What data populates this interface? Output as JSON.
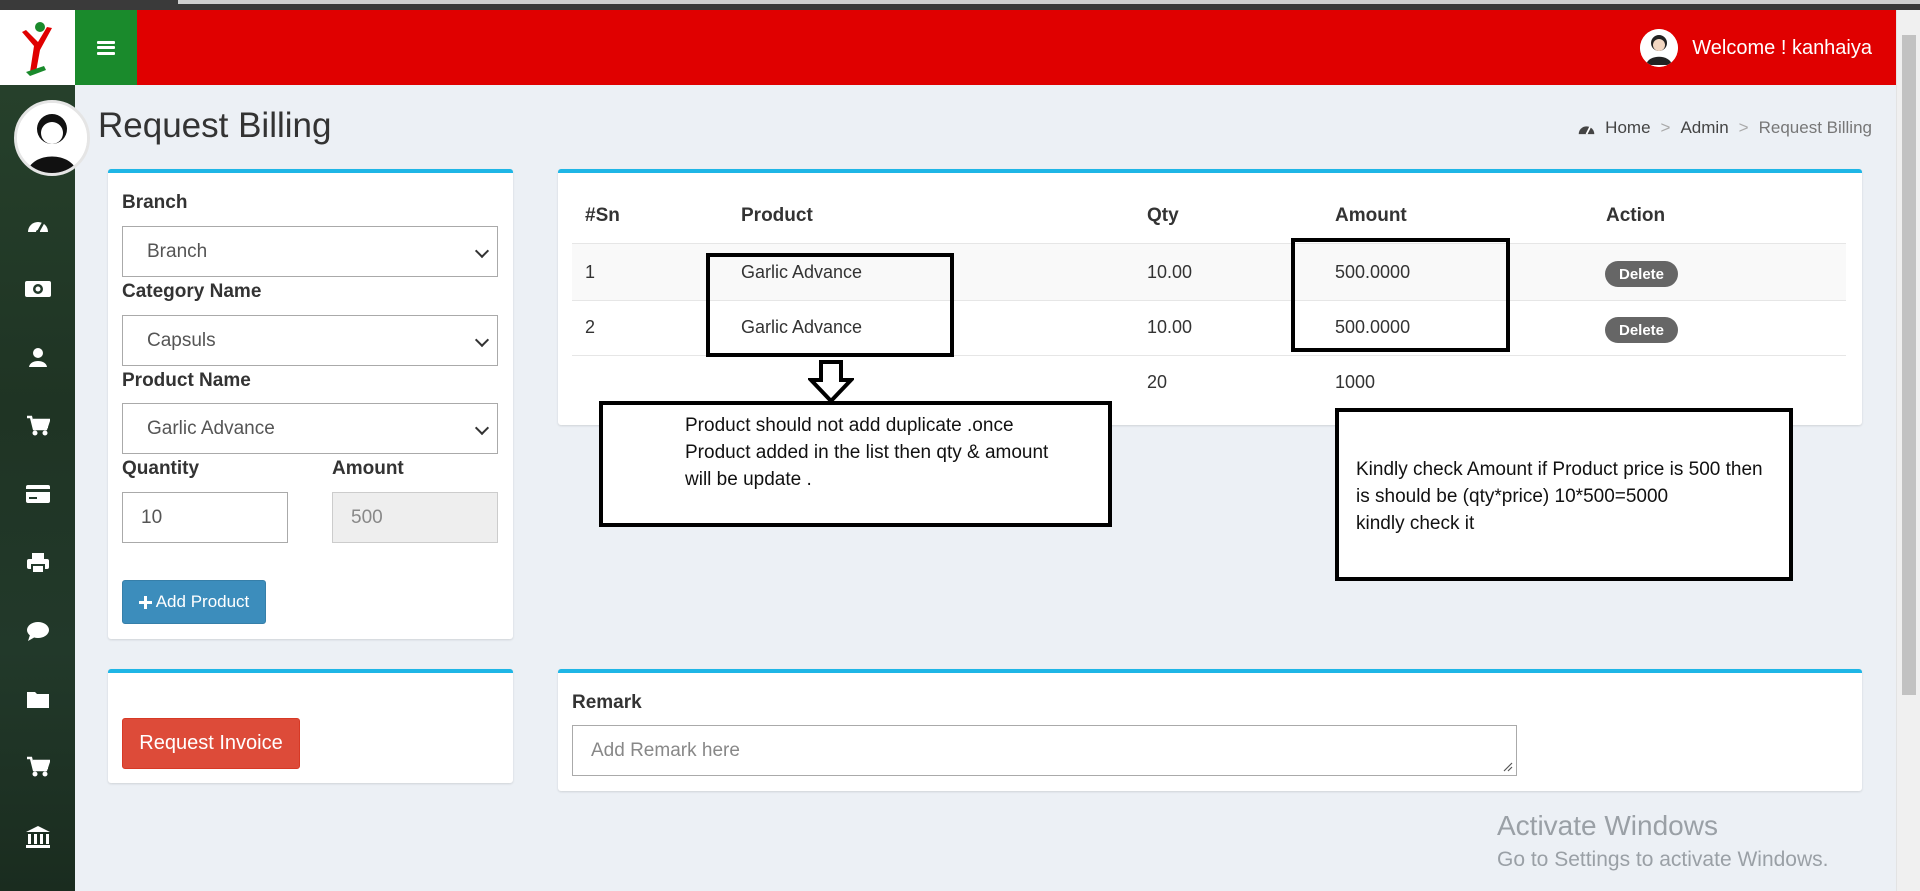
{
  "colors": {
    "navbar": "#e00000",
    "toggle": "#1a8a2c",
    "sidebar": "#22392a",
    "box_border": "#1fb6e6",
    "primary_button": "#3c8dbc",
    "danger_button": "#dd4b39",
    "badge": "#666666"
  },
  "header": {
    "welcome_text": "Welcome ! kanhaiya",
    "menu_icon": "hamburger-icon",
    "logo_icon": "runner-logo-icon"
  },
  "sidebar": {
    "icons": [
      "dashboard-icon",
      "money-icon",
      "user-icon",
      "cart-icon",
      "credit-card-icon",
      "print-icon",
      "comment-icon",
      "folder-icon",
      "cart-icon",
      "bank-icon"
    ]
  },
  "page": {
    "title": "Request Billing",
    "breadcrumb": [
      "Home",
      "Admin",
      "Request Billing"
    ],
    "breadcrumb_separator": ">"
  },
  "form": {
    "branch_label": "Branch",
    "branch_value": "Branch",
    "category_label": "Category Name",
    "category_value": "Capsuls",
    "product_label": "Product Name",
    "product_value": "Garlic Advance",
    "quantity_label": "Quantity",
    "quantity_value": "10",
    "amount_label": "Amount",
    "amount_value": "500",
    "add_button": "Add Product",
    "add_button_icon": "plus-icon"
  },
  "table": {
    "headers": [
      "#Sn",
      "Product",
      "Qty",
      "Amount",
      "Action"
    ],
    "rows": [
      {
        "sn": "1",
        "product": "Garlic Advance",
        "qty": "10.00",
        "amount": "500.0000",
        "action": "Delete"
      },
      {
        "sn": "2",
        "product": "Garlic Advance",
        "qty": "10.00",
        "amount": "500.0000",
        "action": "Delete"
      }
    ],
    "totals": {
      "qty": "20",
      "amount": "1000"
    }
  },
  "annotations": {
    "duplicate_note": [
      "Product should not add duplicate .once",
      "Product added in the list then qty & amount",
      "will be update ."
    ],
    "amount_note": [
      "Kindly check Amount if Product price is 500 then",
      "is should be (qty*price) 10*500=5000",
      "kindly check it"
    ]
  },
  "invoice": {
    "request_button": "Request Invoice"
  },
  "remark": {
    "label": "Remark",
    "placeholder": "Add Remark here"
  },
  "watermark": {
    "line1": "Activate Windows",
    "line2": "Go to Settings to activate Windows."
  }
}
